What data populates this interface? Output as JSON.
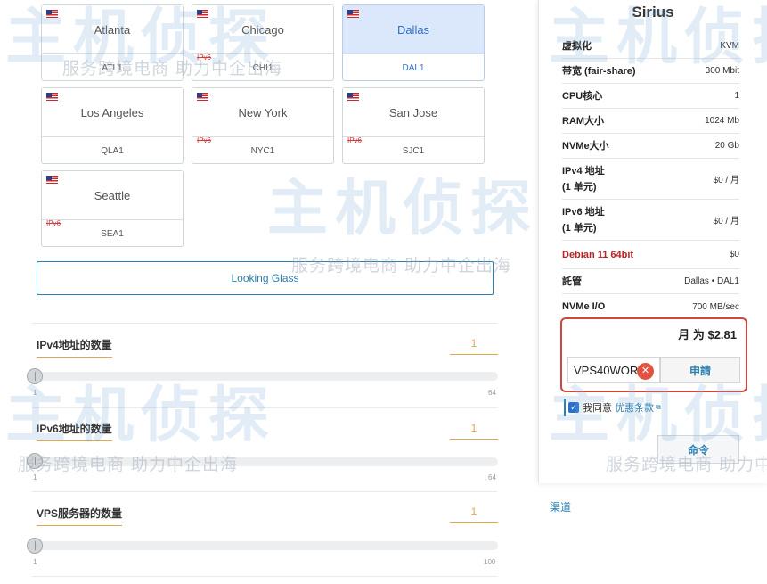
{
  "locations": [
    {
      "city": "Atlanta",
      "code": "ATL1",
      "ipv6_struck": ""
    },
    {
      "city": "Chicago",
      "code": "CHI1",
      "ipv6_struck": "IPv6"
    },
    {
      "city": "Dallas",
      "code": "DAL1",
      "ipv6_struck": ""
    },
    {
      "city": "Los Angeles",
      "code": "QLA1",
      "ipv6_struck": ""
    },
    {
      "city": "New York",
      "code": "NYC1",
      "ipv6_struck": "IPv6"
    },
    {
      "city": "San Jose",
      "code": "SJC1",
      "ipv6_struck": "IPv6"
    },
    {
      "city": "Seattle",
      "code": "SEA1",
      "ipv6_struck": "IPv6"
    }
  ],
  "looking_glass": "Looking Glass",
  "quantities": [
    {
      "label": "IPv4地址的数量",
      "value": "1",
      "min": "1",
      "max": "64"
    },
    {
      "label": "IPv6地址的数量",
      "value": "1",
      "min": "1",
      "max": "64"
    },
    {
      "label": "VPS服务器的数量",
      "value": "1",
      "min": "1",
      "max": "100"
    }
  ],
  "panel": {
    "title": "Sirius",
    "specs": [
      {
        "k": "虚拟化",
        "v": "KVM"
      },
      {
        "k": "带宽 (fair-share)",
        "v": "300 Mbit"
      },
      {
        "k": "CPU核心",
        "v": "1"
      },
      {
        "k": "RAM大小",
        "v": "1024 Mb"
      },
      {
        "k": "NVMe大小",
        "v": "20 Gb"
      },
      {
        "k": "IPv4 地址",
        "k2": "(1 单元)",
        "v": "$0 / 月"
      },
      {
        "k": "IPv6 地址",
        "k2": "(1 单元)",
        "v": "$0 / 月"
      },
      {
        "k": "Debian 11 64bit",
        "v": "$0"
      },
      {
        "k": "託管",
        "v": "Dallas • DAL1"
      },
      {
        "k": "NVMe I/O",
        "v": "700 MB/sec"
      }
    ],
    "total": "月 为 $2.81",
    "coupon_value": "VPS40WOR",
    "apply_label": "申請",
    "agree_text": "我同意",
    "agree_link": "优惠条款",
    "order_label": "命令",
    "channel_label": "渠道"
  },
  "watermark": {
    "brand": "主机侦探",
    "slogan": "服务跨境电商 助力中企出海"
  },
  "colors": {
    "accent": "#2c7fae",
    "highlight": "#d0463a",
    "quantity": "#e3a84a",
    "selected_card": "#dbe8fb"
  }
}
